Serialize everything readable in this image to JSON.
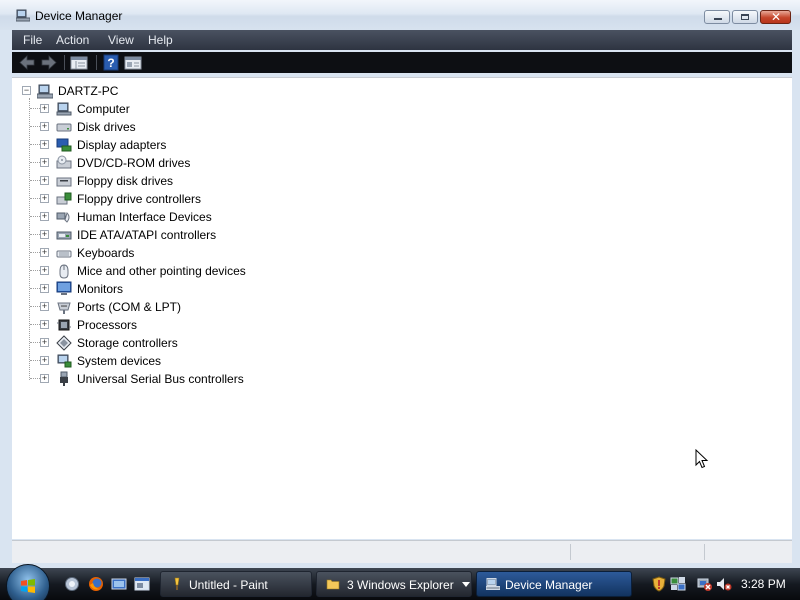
{
  "window": {
    "title": "Device Manager",
    "icon": "device-manager-icon",
    "controls": [
      "minimize",
      "maximize",
      "close"
    ]
  },
  "menubar": {
    "items": [
      {
        "label": "File"
      },
      {
        "label": "Action"
      },
      {
        "label": "View"
      },
      {
        "label": "Help"
      }
    ]
  },
  "toolbar": {
    "buttons": [
      {
        "icon": "back-arrow-icon"
      },
      {
        "icon": "forward-arrow-icon"
      },
      {
        "icon": "properties-icon"
      },
      {
        "icon": "help-icon"
      },
      {
        "icon": "console-tree-icon"
      }
    ]
  },
  "tree": {
    "root": {
      "label": "DARTZ-PC",
      "expander": "−",
      "icon": "computer-icon"
    },
    "items": [
      {
        "label": "Computer",
        "expander": "+",
        "icon": "computer-icon"
      },
      {
        "label": "Disk drives",
        "expander": "+",
        "icon": "disk-drive-icon"
      },
      {
        "label": "Display adapters",
        "expander": "+",
        "icon": "display-adapter-icon"
      },
      {
        "label": "DVD/CD-ROM drives",
        "expander": "+",
        "icon": "dvd-drive-icon"
      },
      {
        "label": "Floppy disk drives",
        "expander": "+",
        "icon": "floppy-drive-icon"
      },
      {
        "label": "Floppy drive controllers",
        "expander": "+",
        "icon": "floppy-controller-icon"
      },
      {
        "label": "Human Interface Devices",
        "expander": "+",
        "icon": "hid-icon"
      },
      {
        "label": "IDE ATA/ATAPI controllers",
        "expander": "+",
        "icon": "ide-controller-icon"
      },
      {
        "label": "Keyboards",
        "expander": "+",
        "icon": "keyboard-icon"
      },
      {
        "label": "Mice and other pointing devices",
        "expander": "+",
        "icon": "mouse-icon"
      },
      {
        "label": "Monitors",
        "expander": "+",
        "icon": "monitor-icon"
      },
      {
        "label": "Ports (COM & LPT)",
        "expander": "+",
        "icon": "port-icon"
      },
      {
        "label": "Processors",
        "expander": "+",
        "icon": "processor-icon"
      },
      {
        "label": "Storage controllers",
        "expander": "+",
        "icon": "storage-controller-icon"
      },
      {
        "label": "System devices",
        "expander": "+",
        "icon": "system-devices-icon"
      },
      {
        "label": "Universal Serial Bus controllers",
        "expander": "+",
        "icon": "usb-icon"
      }
    ]
  },
  "taskbar": {
    "start_icon": "windows-start-orb-icon",
    "quick_launch": [
      {
        "icon": "show-desktop-icon"
      },
      {
        "icon": "firefox-icon"
      },
      {
        "icon": "switch-windows-icon"
      },
      {
        "icon": "window-icon"
      }
    ],
    "tasks": [
      {
        "label": "Untitled - Paint",
        "icon": "paint-icon",
        "active": false
      },
      {
        "label": "3 Windows Explorer",
        "icon": "folder-icon",
        "active": false,
        "has_dropdown": true
      },
      {
        "label": "Device Manager",
        "icon": "device-manager-icon",
        "active": true
      }
    ],
    "tray": [
      {
        "icon": "security-shield-icon"
      },
      {
        "icon": "network-icon"
      },
      {
        "icon": "network-disconnected-icon"
      },
      {
        "icon": "volume-muted-icon"
      }
    ],
    "clock": "3:28 PM"
  }
}
